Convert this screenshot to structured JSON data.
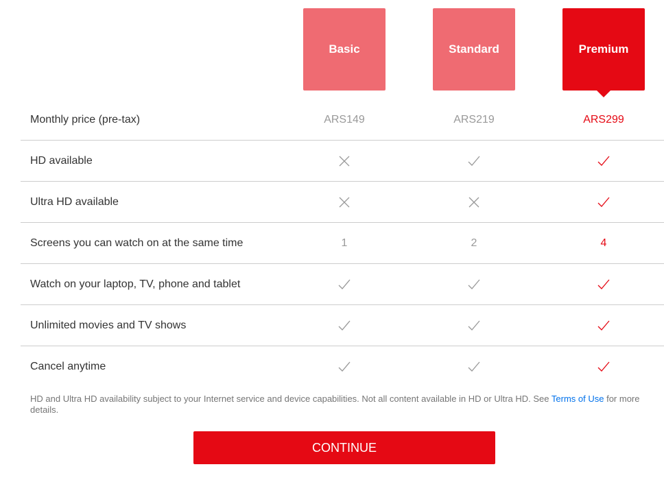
{
  "plans": [
    {
      "name": "Basic",
      "selected": false
    },
    {
      "name": "Standard",
      "selected": false
    },
    {
      "name": "Premium",
      "selected": true
    }
  ],
  "rows": [
    {
      "label": "Monthly price (pre-tax)",
      "values": [
        "ARS149",
        "ARS219",
        "ARS299"
      ]
    },
    {
      "label": "HD available",
      "values": [
        "cross-icon",
        "check-icon",
        "check-icon"
      ]
    },
    {
      "label": "Ultra HD available",
      "values": [
        "cross-icon",
        "cross-icon",
        "check-icon"
      ]
    },
    {
      "label": "Screens you can watch on at the same time",
      "values": [
        "1",
        "2",
        "4"
      ]
    },
    {
      "label": "Watch on your laptop, TV, phone and tablet",
      "values": [
        "check-icon",
        "check-icon",
        "check-icon"
      ]
    },
    {
      "label": "Unlimited movies and TV shows",
      "values": [
        "check-icon",
        "check-icon",
        "check-icon"
      ]
    },
    {
      "label": "Cancel anytime",
      "values": [
        "check-icon",
        "check-icon",
        "check-icon"
      ]
    }
  ],
  "note": {
    "before": "HD and Ultra HD availability subject to your Internet service and device capabilities. Not all content available in HD or Ultra HD. See ",
    "link": "Terms of Use",
    "after": " for more details."
  },
  "continue_label": "CONTINUE",
  "colors": {
    "accent": "#e50914",
    "plan_unselected": "#ef6b72",
    "muted": "#999999",
    "link": "#0071eb"
  }
}
